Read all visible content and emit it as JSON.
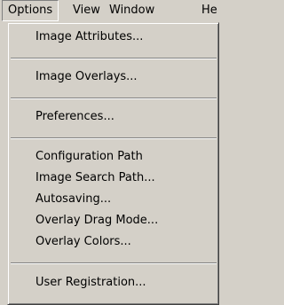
{
  "menubar": {
    "items": [
      {
        "label": "Options"
      },
      {
        "label": "View"
      },
      {
        "label": "Window"
      },
      {
        "label": "He"
      }
    ]
  },
  "options_menu": {
    "items": [
      {
        "label": "Image Attributes..."
      },
      {
        "label": "Image Overlays..."
      },
      {
        "label": "Preferences..."
      },
      {
        "label": "Configuration Path"
      },
      {
        "label": "Image Search Path..."
      },
      {
        "label": "Autosaving..."
      },
      {
        "label": "Overlay Drag Mode..."
      },
      {
        "label": "Overlay Colors..."
      },
      {
        "label": "User Registration..."
      }
    ]
  },
  "colors": {
    "face": "#d4d0c8",
    "shadow": "#808080",
    "highlight": "#ffffff",
    "dark_shadow": "#404040"
  }
}
